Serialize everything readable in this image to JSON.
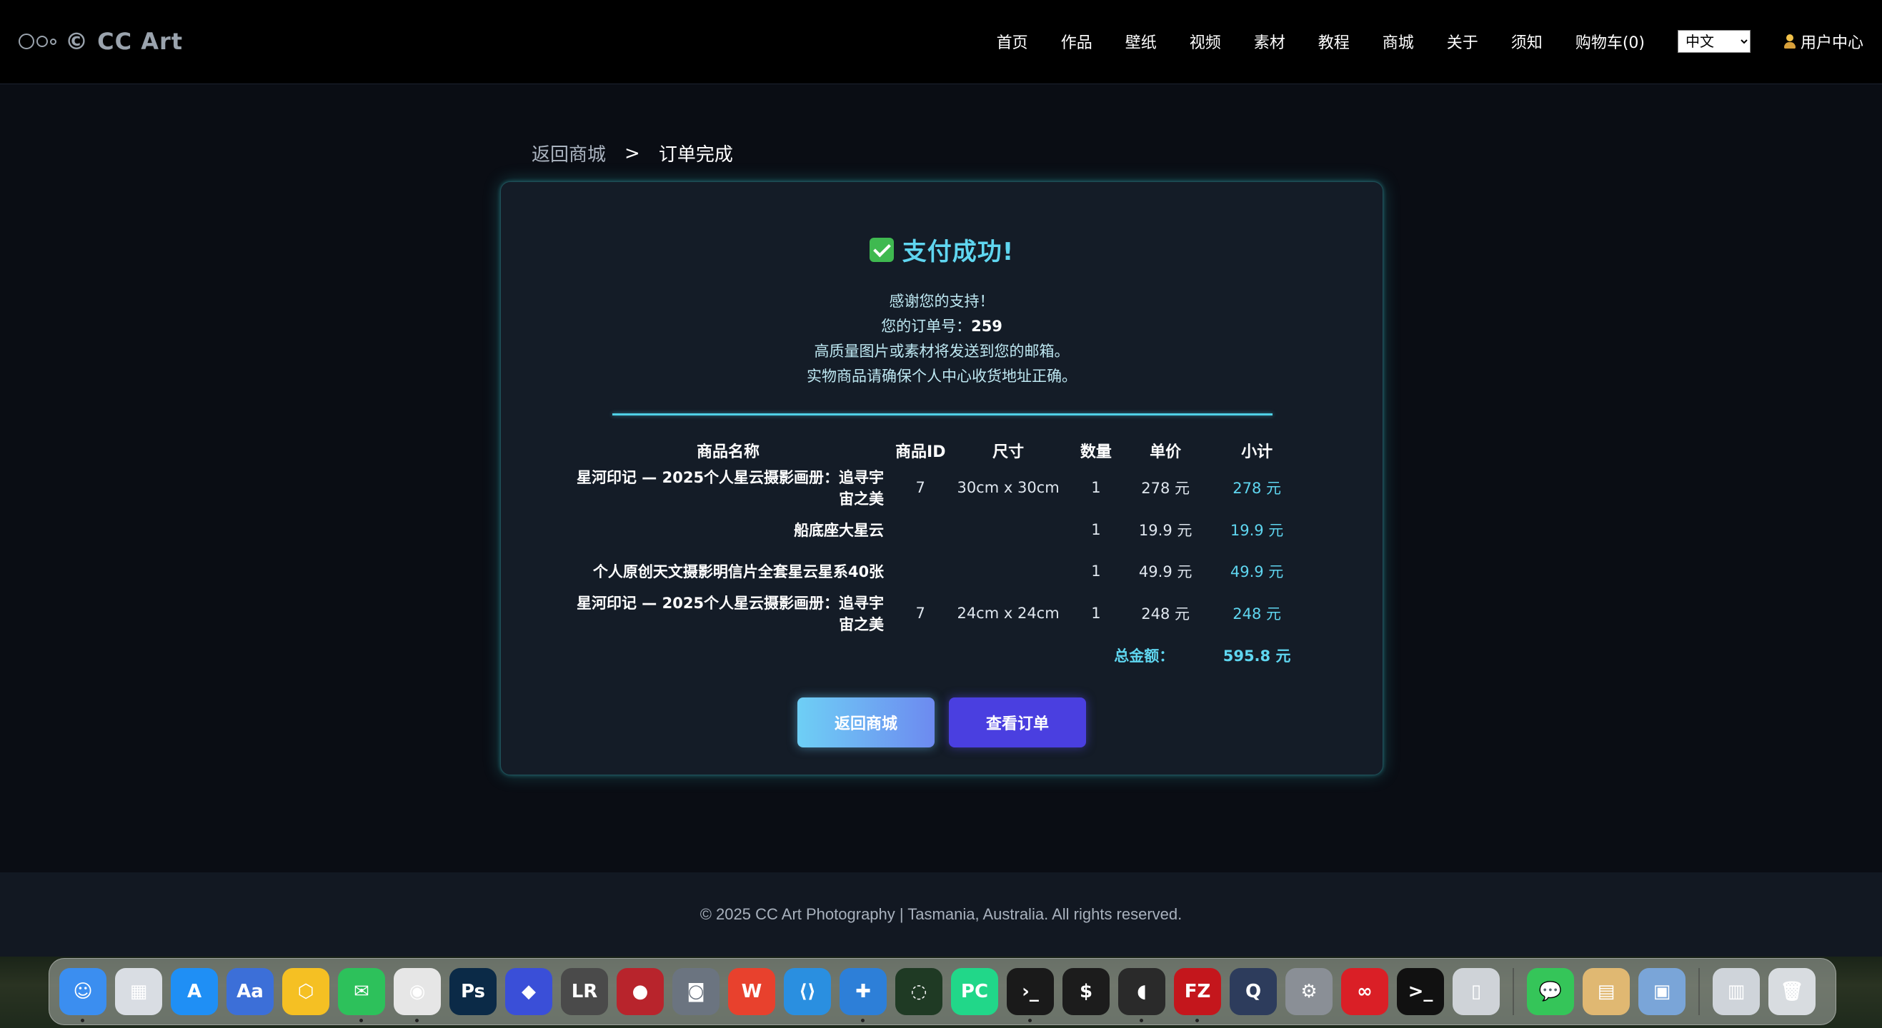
{
  "header": {
    "logo_text": "© CC Art",
    "nav": [
      {
        "label": "首页",
        "name": "nav-home"
      },
      {
        "label": "作品",
        "name": "nav-works"
      },
      {
        "label": "壁纸",
        "name": "nav-wallpaper"
      },
      {
        "label": "视频",
        "name": "nav-video"
      },
      {
        "label": "素材",
        "name": "nav-assets"
      },
      {
        "label": "教程",
        "name": "nav-tutorials"
      },
      {
        "label": "商城",
        "name": "nav-shop"
      },
      {
        "label": "关于",
        "name": "nav-about"
      },
      {
        "label": "须知",
        "name": "nav-notice"
      },
      {
        "label": "购物车(0)",
        "name": "nav-cart"
      }
    ],
    "language": "中文",
    "user_center": "用户中心"
  },
  "breadcrumb": {
    "back": "返回商城",
    "separator": ">",
    "current": "订单完成"
  },
  "result": {
    "title": "支付成功!",
    "thanks": "感谢您的支持！",
    "order_label": "您的订单号：",
    "order_number": "259",
    "email_note": "高质量图片或素材将发送到您的邮箱。",
    "address_note": "实物商品请确保个人中心收货地址正确。"
  },
  "table": {
    "headers": [
      "商品名称",
      "商品ID",
      "尺寸",
      "数量",
      "单价",
      "小计"
    ],
    "rows": [
      [
        "星河印记 — 2025个人星云摄影画册：追寻宇宙之美",
        "7",
        "30cm x 30cm",
        "1",
        "278 元",
        "278 元"
      ],
      [
        "船底座大星云",
        "",
        "",
        "1",
        "19.9 元",
        "19.9 元"
      ],
      [
        "个人原创天文摄影明信片全套星云星系40张",
        "",
        "",
        "1",
        "49.9 元",
        "49.9 元"
      ],
      [
        "星河印记 — 2025个人星云摄影画册：追寻宇宙之美",
        "7",
        "24cm x 24cm",
        "1",
        "248 元",
        "248 元"
      ]
    ],
    "total_label": "总金额：",
    "total_value": "595.8 元"
  },
  "buttons": {
    "back_shop": "返回商城",
    "view_orders": "查看订单"
  },
  "footer": {
    "copyright": "© 2025 CC Art Photography | Tasmania, Australia. All rights reserved."
  },
  "dock": [
    {
      "name": "finder-icon",
      "color": "#3b8ef0",
      "glyph": "☺"
    },
    {
      "name": "launchpad-icon",
      "color": "#d9dde3",
      "glyph": "▦"
    },
    {
      "name": "app-store-icon",
      "color": "#1f8ff5",
      "glyph": "A"
    },
    {
      "name": "dictionary-icon",
      "color": "#3c6fd8",
      "glyph": "Aa"
    },
    {
      "name": "notes-app-icon",
      "color": "#f5c023",
      "glyph": "⬡"
    },
    {
      "name": "wechat-icon",
      "color": "#2dc15b",
      "glyph": "✉"
    },
    {
      "name": "chrome-icon",
      "color": "#e6e6e6",
      "glyph": "◉"
    },
    {
      "name": "photoshop-icon",
      "color": "#0b2a47",
      "glyph": "Ps"
    },
    {
      "name": "crystal-app-icon",
      "color": "#3a4fd8",
      "glyph": "◆"
    },
    {
      "name": "lrtimelapse-icon",
      "color": "#4a4a4a",
      "glyph": "LR"
    },
    {
      "name": "photo-app-icon",
      "color": "#b8242c",
      "glyph": "●"
    },
    {
      "name": "camera-app-icon",
      "color": "#6b7480",
      "glyph": "◙"
    },
    {
      "name": "wps-icon",
      "color": "#e8412d",
      "glyph": "W"
    },
    {
      "name": "vscode-icon",
      "color": "#2a8fe0",
      "glyph": "⟨⟩"
    },
    {
      "name": "plus-app-icon",
      "color": "#2d7fd8",
      "glyph": "✚"
    },
    {
      "name": "loader-app-icon",
      "color": "#1f3a24",
      "glyph": "◌"
    },
    {
      "name": "pycharm-icon",
      "color": "#21d789",
      "glyph": "PC"
    },
    {
      "name": "terminal-pink-icon",
      "color": "#1a1a1a",
      "glyph": "›_"
    },
    {
      "name": "terminal-icon",
      "color": "#1c1c1c",
      "glyph": "$"
    },
    {
      "name": "elephant-app-icon",
      "color": "#2a2a2a",
      "glyph": "◖"
    },
    {
      "name": "filezilla-icon",
      "color": "#c4161c",
      "glyph": "FZ"
    },
    {
      "name": "quicktime-icon",
      "color": "#2d3c5c",
      "glyph": "Q"
    },
    {
      "name": "system-settings-icon",
      "color": "#8a8f96",
      "glyph": "⚙"
    },
    {
      "name": "creative-cloud-icon",
      "color": "#da1f26",
      "glyph": "∞"
    },
    {
      "name": "terminal-dark-icon",
      "color": "#111",
      "glyph": ">_"
    },
    {
      "name": "iphone-mirroring-icon",
      "color": "#cfd3d8",
      "glyph": "▯"
    },
    {
      "name": "messages-icon",
      "color": "#35c559",
      "glyph": "💬"
    },
    {
      "name": "archive-icon",
      "color": "#e0b872",
      "glyph": "▤"
    },
    {
      "name": "preview-icon",
      "color": "#7aa5d8",
      "glyph": "▣"
    },
    {
      "name": "downloads-folder-icon",
      "color": "#cfd4da",
      "glyph": "▥"
    },
    {
      "name": "trash-icon",
      "color": "#d8dce0",
      "glyph": "🗑"
    }
  ]
}
